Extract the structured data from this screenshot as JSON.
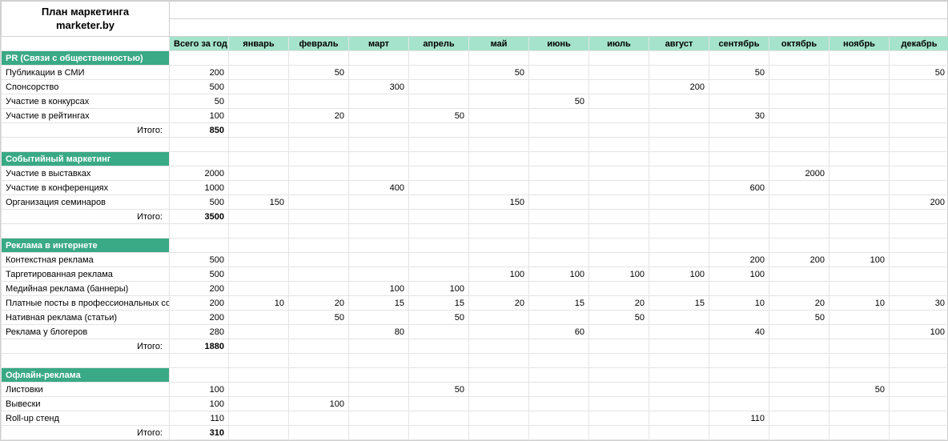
{
  "title_line1": "План маркетинга",
  "title_line2": "marketer.by",
  "year_total_header": "Всего за год",
  "months": [
    "январь",
    "февраль",
    "март",
    "апрель",
    "май",
    "июнь",
    "июль",
    "август",
    "сентябрь",
    "октябрь",
    "ноябрь",
    "декабрь"
  ],
  "total_label": "Итого:",
  "sections": [
    {
      "name": "PR (Связи с общественностью)",
      "rows": [
        {
          "label": "Публикации в СМИ",
          "year": 200,
          "m": [
            null,
            50,
            null,
            null,
            50,
            null,
            null,
            null,
            50,
            null,
            null,
            50
          ]
        },
        {
          "label": "Спонсорство",
          "year": 500,
          "m": [
            null,
            null,
            300,
            null,
            null,
            null,
            null,
            200,
            null,
            null,
            null,
            null
          ]
        },
        {
          "label": "Участие в конкурсах",
          "year": 50,
          "m": [
            null,
            null,
            null,
            null,
            null,
            50,
            null,
            null,
            null,
            null,
            null,
            null
          ]
        },
        {
          "label": "Участие в рейтингах",
          "year": 100,
          "m": [
            null,
            20,
            null,
            50,
            null,
            null,
            null,
            null,
            30,
            null,
            null,
            null
          ]
        }
      ],
      "total": 850
    },
    {
      "name": "Событийный маркетинг",
      "rows": [
        {
          "label": "Участие в выставках",
          "year": 2000,
          "m": [
            null,
            null,
            null,
            null,
            null,
            null,
            null,
            null,
            null,
            2000,
            null,
            null
          ]
        },
        {
          "label": "Участие в конференциях",
          "year": 1000,
          "m": [
            null,
            null,
            400,
            null,
            null,
            null,
            null,
            null,
            600,
            null,
            null,
            null
          ]
        },
        {
          "label": "Организация семинаров",
          "year": 500,
          "m": [
            150,
            null,
            null,
            null,
            150,
            null,
            null,
            null,
            null,
            null,
            null,
            200
          ]
        }
      ],
      "total": 3500
    },
    {
      "name": "Реклама в интернете",
      "rows": [
        {
          "label": "Контекстная реклама",
          "year": 500,
          "m": [
            null,
            null,
            null,
            null,
            null,
            null,
            null,
            null,
            200,
            200,
            100,
            null
          ]
        },
        {
          "label": "Таргетированная реклама",
          "year": 500,
          "m": [
            null,
            null,
            null,
            null,
            100,
            100,
            100,
            100,
            100,
            null,
            null,
            null
          ]
        },
        {
          "label": "Медийная реклама (баннеры)",
          "year": 200,
          "m": [
            null,
            null,
            100,
            100,
            null,
            null,
            null,
            null,
            null,
            null,
            null,
            null
          ]
        },
        {
          "label": "Платные посты в профессиональных сообществах",
          "year": 200,
          "m": [
            10,
            20,
            15,
            15,
            20,
            15,
            20,
            15,
            10,
            20,
            10,
            30
          ]
        },
        {
          "label": "Нативная реклама (статьи)",
          "year": 200,
          "m": [
            null,
            50,
            null,
            50,
            null,
            null,
            50,
            null,
            null,
            50,
            null,
            null
          ]
        },
        {
          "label": "Реклама у блогеров",
          "year": 280,
          "m": [
            null,
            null,
            80,
            null,
            null,
            60,
            null,
            null,
            40,
            null,
            null,
            100
          ]
        }
      ],
      "total": 1880
    },
    {
      "name": "Офлайн-реклама",
      "rows": [
        {
          "label": "Листовки",
          "year": 100,
          "m": [
            null,
            null,
            null,
            50,
            null,
            null,
            null,
            null,
            null,
            null,
            50,
            null
          ]
        },
        {
          "label": "Вывески",
          "year": 100,
          "m": [
            null,
            100,
            null,
            null,
            null,
            null,
            null,
            null,
            null,
            null,
            null,
            null
          ]
        },
        {
          "label": "Roll-up стенд",
          "year": 110,
          "m": [
            null,
            null,
            null,
            null,
            null,
            null,
            null,
            null,
            110,
            null,
            null,
            null
          ]
        }
      ],
      "total": 310
    }
  ]
}
